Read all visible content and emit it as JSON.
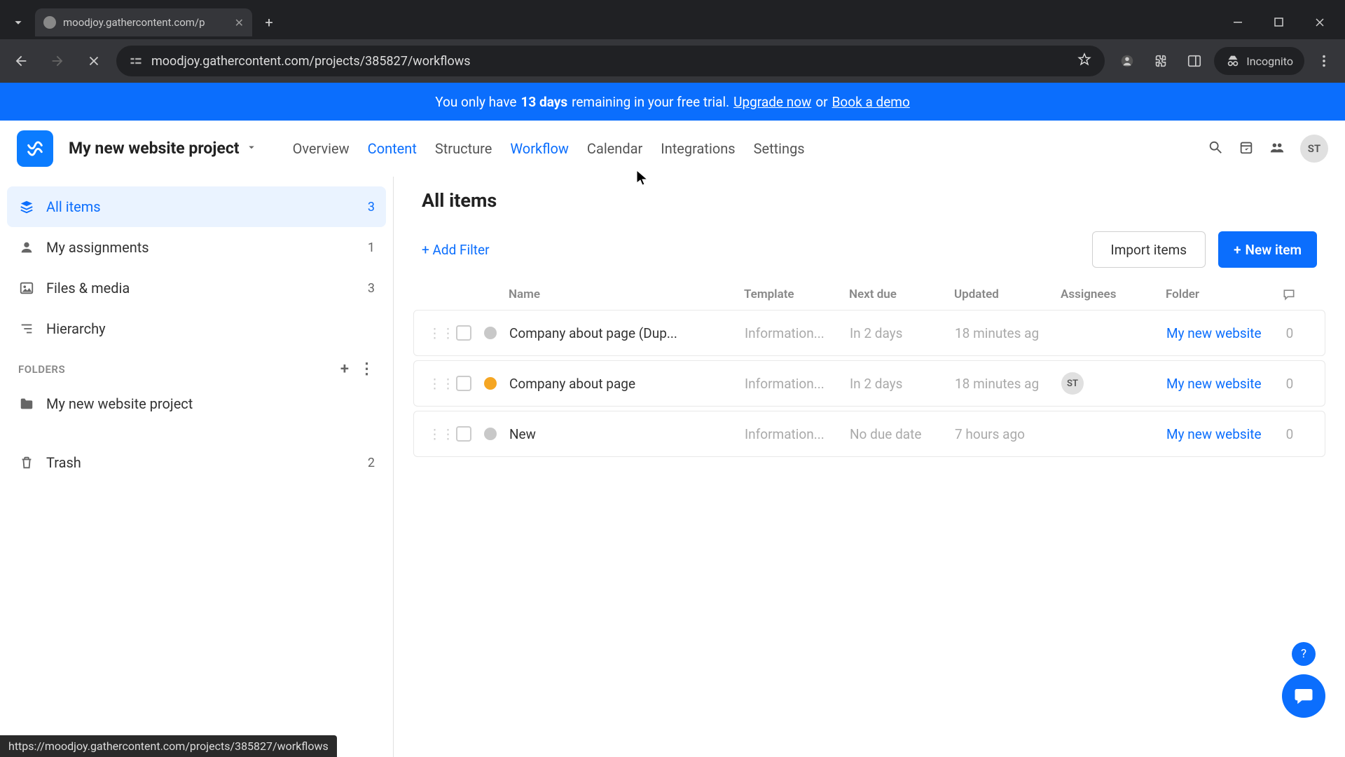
{
  "browser": {
    "tab_title": "moodjoy.gathercontent.com/p",
    "url": "moodjoy.gathercontent.com/projects/385827/workflows",
    "incognito_label": "Incognito",
    "status_url": "https://moodjoy.gathercontent.com/projects/385827/workflows"
  },
  "banner": {
    "prefix": "You only have ",
    "days": "13 days",
    "middle": " remaining in your free trial. ",
    "upgrade": "Upgrade now",
    "or": " or ",
    "demo": "Book a demo"
  },
  "header": {
    "project": "My new website project",
    "tabs": [
      "Overview",
      "Content",
      "Structure",
      "Workflow",
      "Calendar",
      "Integrations",
      "Settings"
    ],
    "active_tab": "Content",
    "hover_tab": "Workflow",
    "avatar": "ST"
  },
  "sidebar": {
    "items": [
      {
        "label": "All items",
        "count": "3"
      },
      {
        "label": "My assignments",
        "count": "1"
      },
      {
        "label": "Files & media",
        "count": "3"
      },
      {
        "label": "Hierarchy",
        "count": ""
      }
    ],
    "folders_label": "FOLDERS",
    "folders": [
      {
        "label": "My new website project"
      }
    ],
    "trash": {
      "label": "Trash",
      "count": "2"
    }
  },
  "content": {
    "title": "All items",
    "add_filter": "+ Add Filter",
    "import": "Import items",
    "new_item": "New item"
  },
  "table": {
    "headers": {
      "name": "Name",
      "template": "Template",
      "due": "Next due",
      "updated": "Updated",
      "assignees": "Assignees",
      "folder": "Folder"
    },
    "rows": [
      {
        "status": "grey",
        "name": "Company about page (Dup...",
        "template": "Information...",
        "due": "In 2 days",
        "updated": "18 minutes ag",
        "assignee": "",
        "folder": "My new website",
        "comments": "0"
      },
      {
        "status": "orange",
        "name": "Company about page",
        "template": "Information...",
        "due": "In 2 days",
        "updated": "18 minutes ag",
        "assignee": "ST",
        "folder": "My new website",
        "comments": "0"
      },
      {
        "status": "grey",
        "name": "New",
        "template": "Information...",
        "due": "No due date",
        "updated": "7 hours ago",
        "assignee": "",
        "folder": "My new website",
        "comments": "0"
      }
    ]
  }
}
